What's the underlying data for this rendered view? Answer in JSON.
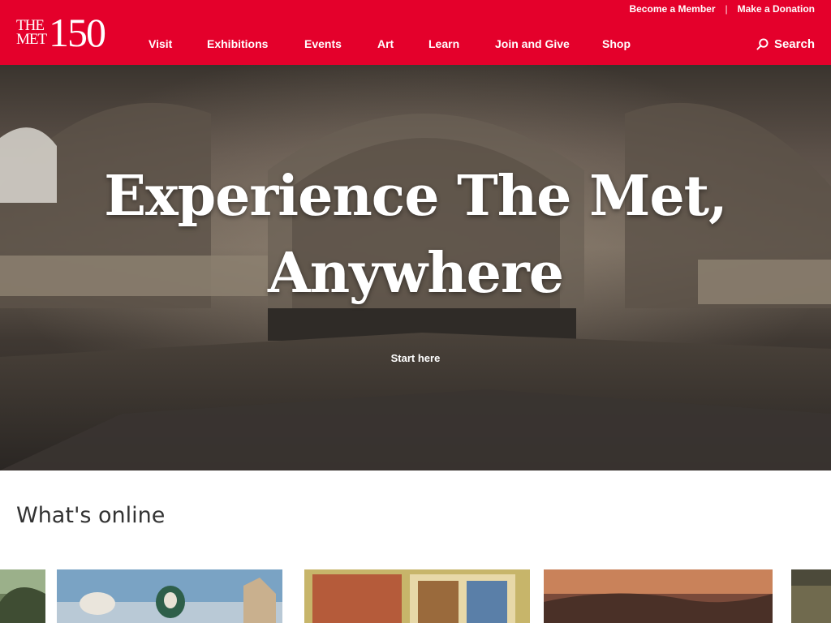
{
  "header": {
    "brand_color": "#e4002b",
    "logo": {
      "top_text": "THE",
      "bottom_text": "MET",
      "number": "150"
    },
    "utility_links": [
      "Become a Member",
      "Make a Donation"
    ],
    "nav": [
      "Visit",
      "Exhibitions",
      "Events",
      "Art",
      "Learn",
      "Join and Give",
      "Shop"
    ],
    "search_label": "Search"
  },
  "hero": {
    "heading_line1": "Experience The Met,",
    "heading_line2": "Anywhere",
    "cta_label": "Start here"
  },
  "online": {
    "title": "What's online"
  },
  "icons": [
    "search-icon"
  ]
}
